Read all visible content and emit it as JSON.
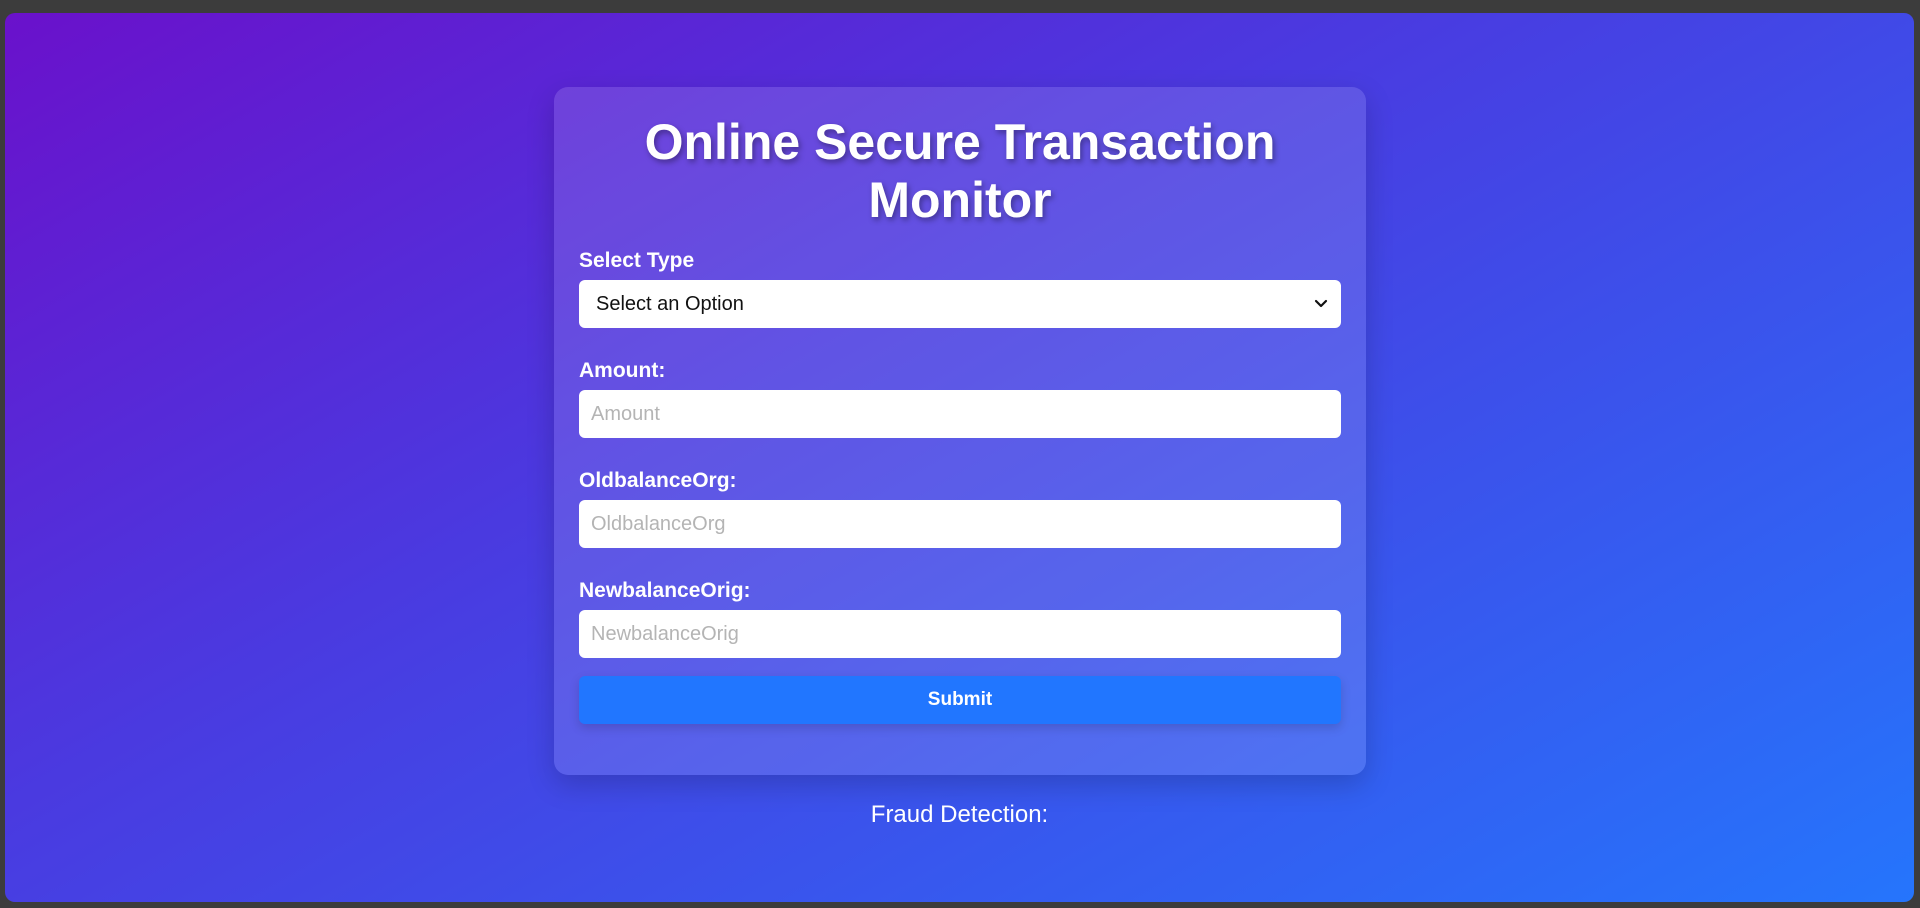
{
  "form": {
    "title": "Online Secure Transaction Monitor",
    "type_label": "Select Type",
    "type_selected": "Select an Option",
    "amount_label": "Amount:",
    "amount_placeholder": "Amount",
    "oldbalance_label": "OldbalanceOrg:",
    "oldbalance_placeholder": "OldbalanceOrg",
    "newbalance_label": "NewbalanceOrig:",
    "newbalance_placeholder": "NewbalanceOrig",
    "submit_label": "Submit"
  },
  "result": {
    "label": "Fraud Detection:"
  },
  "icons": {
    "select_dropdown": "chevron-down-icon"
  },
  "colors": {
    "gradient_start": "#6a11cb",
    "gradient_end": "#2575fc",
    "submit_button": "#2176ff"
  }
}
